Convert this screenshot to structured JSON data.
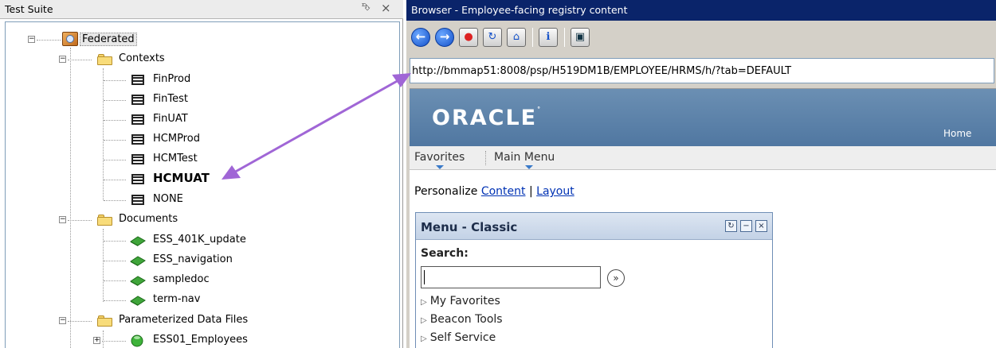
{
  "left_panel": {
    "title": "Test Suite",
    "pin_glyph": "⮷",
    "close_glyph": "×",
    "root": {
      "label": "Federated",
      "icon": "federated-icon",
      "toggle": "−"
    },
    "contexts": {
      "label": "Contexts",
      "toggle": "−",
      "items": [
        "FinProd",
        "FinTest",
        "FinUAT",
        "HCMProd",
        "HCMTest",
        "HCMUAT",
        "NONE"
      ]
    },
    "documents": {
      "label": "Documents",
      "toggle": "−",
      "items": [
        "ESS_401K_update",
        "ESS_navigation",
        "sampledoc",
        "term-nav"
      ]
    },
    "param_files": {
      "label": "Parameterized Data Files",
      "toggle": "−",
      "items": [
        {
          "label": "ESS01_Employees",
          "toggle": "+"
        }
      ]
    }
  },
  "browser": {
    "title": "Browser - Employee-facing registry content",
    "toolbar": {
      "back_glyph": "←",
      "forward_glyph": "→",
      "stop_glyph": "●",
      "refresh_glyph": "↻",
      "home_glyph": "⌂",
      "page_glyph": "ℹ",
      "view_glyph": "▣"
    },
    "address": "http://bmmap51:8008/psp/H519DM1B/EMPLOYEE/HRMS/h/?tab=DEFAULT",
    "page": {
      "logo": "ORACLE",
      "logo_mark": "°",
      "home_link": "Home",
      "menu_favorites": "Favorites",
      "menu_main": "Main Menu",
      "personalize_prefix": "Personalize",
      "personalize_content": "Content",
      "personalize_sep": "|",
      "personalize_layout": "Layout",
      "pagelet": {
        "title": "Menu - Classic",
        "refresh_glyph": "↻",
        "minimize_glyph": "−",
        "close_glyph": "×",
        "search_label": "Search:",
        "search_value": "",
        "go_glyph": "»",
        "link_marker": "▷",
        "links": [
          "My Favorites",
          "Beacon Tools",
          "Self Service"
        ]
      }
    }
  },
  "colors": {
    "browser_title_bg": "#0a246a",
    "oracle_bar": "#5a80a8",
    "arrow": "#a066d6",
    "link": "#0032b4"
  }
}
